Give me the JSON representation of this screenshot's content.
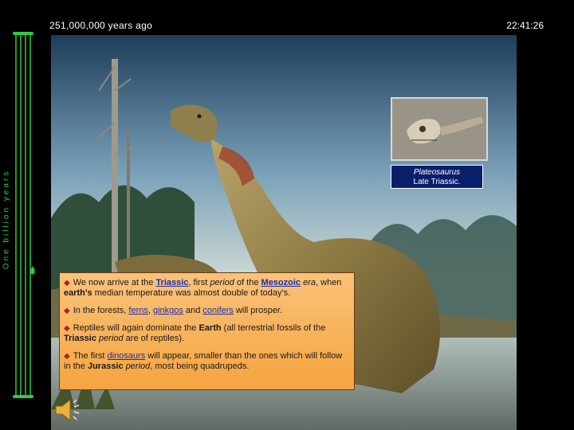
{
  "header": {
    "time_ago": "251,000,000 years ago",
    "clock": "22:41:26"
  },
  "timeline": {
    "label": "One billion years"
  },
  "caption": {
    "name": "Plateosaurus",
    "period": "Late Triassic."
  },
  "text": {
    "p1": {
      "a": "We now arrive at the ",
      "link1": "Triassic",
      "b": ", first ",
      "c": "period",
      "d": " of the ",
      "link2": "Mesozoic",
      "e": " era",
      "f": ", when ",
      "g": "earth's",
      "h": " median temperature was almost double of today's."
    },
    "p2": {
      "a": "In the forests, ",
      "l1": "ferns",
      "b": ", ",
      "l2": "ginkgos",
      "c": " and ",
      "l3": "conifers",
      "d": " will prosper."
    },
    "p3": {
      "a": "Reptiles will again dominate the ",
      "b": "Earth",
      "c": " (all terrestrial fossils of the ",
      "d": "Triassic",
      "e": " ",
      "f": "period",
      "g": " are of reptiles)."
    },
    "p4": {
      "a": "The first ",
      "link": "dinosaurs",
      "b": " will appear, smaller than the ones which will follow in the ",
      "c": "Jurassic",
      "d": " ",
      "e": "period",
      "f": ", most being quadrupeds."
    }
  },
  "icons": {
    "bullet": "diamond-icon",
    "speaker": "speaker-icon"
  },
  "colors": {
    "accent_green": "#2ecc40",
    "text_box": "#f8b45a",
    "caption_bg": "#0a1f6b",
    "link": "#1a2fb0"
  }
}
